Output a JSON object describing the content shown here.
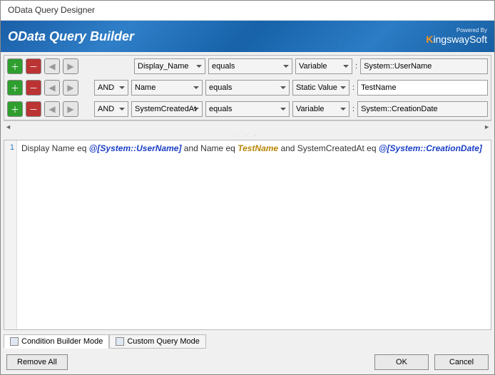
{
  "window": {
    "title": "OData Query Designer"
  },
  "banner": {
    "heading": "OData Query Builder",
    "powered_by": "Powered By",
    "brand_prefix": "K",
    "brand_rest": "ingswaySoft"
  },
  "builder": {
    "rows": [
      {
        "logic": "",
        "field": "Display_Name",
        "operator": "equals",
        "value_type": "Variable",
        "value": "System::UserName",
        "value_editable": false
      },
      {
        "logic": "AND",
        "field": "Name",
        "operator": "equals",
        "value_type": "Static Value",
        "value": "TestName",
        "value_editable": true
      },
      {
        "logic": "AND",
        "field": "SystemCreatedAt",
        "operator": "equals",
        "value_type": "Variable",
        "value": "System::CreationDate",
        "value_editable": false
      }
    ]
  },
  "code": {
    "line_no": "1",
    "tokens": [
      {
        "t": "Display Name eq ",
        "c": ""
      },
      {
        "t": "@[System::UserName]",
        "c": "tok-var"
      },
      {
        "t": " and Name eq ",
        "c": ""
      },
      {
        "t": "TestName",
        "c": "tok-lit"
      },
      {
        "t": " and SystemCreatedAt eq ",
        "c": ""
      },
      {
        "t": "@[System::CreationDate]",
        "c": "tok-var"
      }
    ]
  },
  "tabs": {
    "builder": "Condition Builder Mode",
    "custom": "Custom Query Mode"
  },
  "footer": {
    "remove_all": "Remove All",
    "ok": "OK",
    "cancel": "Cancel"
  }
}
